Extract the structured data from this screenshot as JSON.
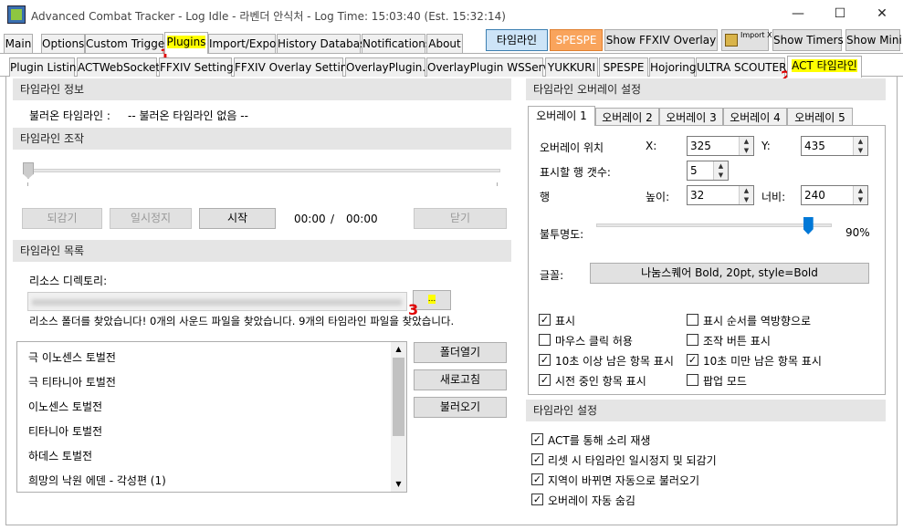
{
  "window": {
    "title": "Advanced Combat Tracker - Log Idle - 라벤더 안식처 - Log Time: 15:03:40 (Est. 15:32:14)",
    "min": "—",
    "max": "☐",
    "close": "✕"
  },
  "main_tabs": [
    "Main",
    "Options",
    "Custom Triggers",
    "Plugins",
    "Import/Export",
    "History Database",
    "Notifications",
    "About"
  ],
  "toolbar": {
    "timeline": "타임라인",
    "spespe": "SPESPE",
    "show_overlay": "Show FFXIV Overlay",
    "import_xml": "Import XML",
    "show_timers": "Show Timers",
    "show_mini": "Show Mini"
  },
  "plugin_tabs": [
    "Plugin Listing",
    "ACTWebSocket",
    "FFXIV Settings",
    "FFXIV Overlay Settings",
    "OverlayPlugin.dll",
    "OverlayPlugin WSServer",
    "YUKKURI",
    "SPESPE",
    "Hojoring",
    "ULTRA SCOUTER",
    "ACT 타임라인"
  ],
  "annotations": {
    "one": "1",
    "two": "2",
    "three": "3"
  },
  "timeline_info": {
    "header": "타임라인 정보",
    "loaded_label": "불러온 타임라인 :",
    "loaded_value": "-- 불러온 타임라인 없음 --"
  },
  "timeline_control": {
    "header": "타임라인 조작",
    "rewind": "되감기",
    "pause": "일시정지",
    "start": "시작",
    "current": "00:00",
    "sep": "/",
    "total": "00:00",
    "close": "닫기"
  },
  "timeline_list": {
    "header": "타임라인 목록",
    "resource_dir": "리소스 디렉토리:",
    "browse": "...",
    "status": "리소스 폴더를 찾았습니다! 0개의 사운드 파일을 찾았습니다. 9개의 타임라인 파일을 찾았습니다.",
    "open_folder": "폴더열기",
    "refresh": "새로고침",
    "load": "불러오기",
    "items": [
      "극 이노센스 토벌전",
      "극 티타니아 토벌전",
      "이노센스 토벌전",
      "티타니아 토벌전",
      "하데스 토벌전",
      "희망의 낙원 에덴 - 각성편 (1)"
    ]
  },
  "overlay_settings": {
    "header": "타임라인 오버레이 설정",
    "tabs": [
      "오버레이 1",
      "오버레이 2",
      "오버레이 3",
      "오버레이 4",
      "오버레이 5"
    ],
    "position_label": "오버레이 위치",
    "x_label": "X:",
    "x_value": "325",
    "y_label": "Y:",
    "y_value": "435",
    "rows_label": "표시할 행 갯수:",
    "rows_value": "5",
    "row_label": "행",
    "height_label": "높이:",
    "height_value": "32",
    "width_label": "너비:",
    "width_value": "240",
    "opacity_label": "불투명도:",
    "opacity_value": "90%",
    "opacity_level": 0.9,
    "font_label": "글꼴:",
    "font_value": "나눔스퀘어 Bold, 20pt, style=Bold",
    "checks": [
      {
        "label": "표시",
        "checked": true
      },
      {
        "label": "표시 순서를 역방향으로",
        "checked": false
      },
      {
        "label": "마우스 클릭 허용",
        "checked": false
      },
      {
        "label": "조작 버튼 표시",
        "checked": false
      },
      {
        "label": "10초 이상 남은 항목 표시",
        "checked": true
      },
      {
        "label": "10초 미만 남은 항목 표시",
        "checked": true
      },
      {
        "label": "시전 중인 항목 표시",
        "checked": true
      },
      {
        "label": "팝업 모드",
        "checked": false
      }
    ]
  },
  "timeline_settings": {
    "header": "타임라인 설정",
    "checks": [
      {
        "label": "ACT를 통해 소리 재생",
        "checked": true
      },
      {
        "label": "리셋 시 타임라인 일시정지 및 되감기",
        "checked": true
      },
      {
        "label": "지역이 바뀌면 자동으로 불러오기",
        "checked": true
      },
      {
        "label": "오버레이 자동 숨김",
        "checked": true
      }
    ]
  }
}
